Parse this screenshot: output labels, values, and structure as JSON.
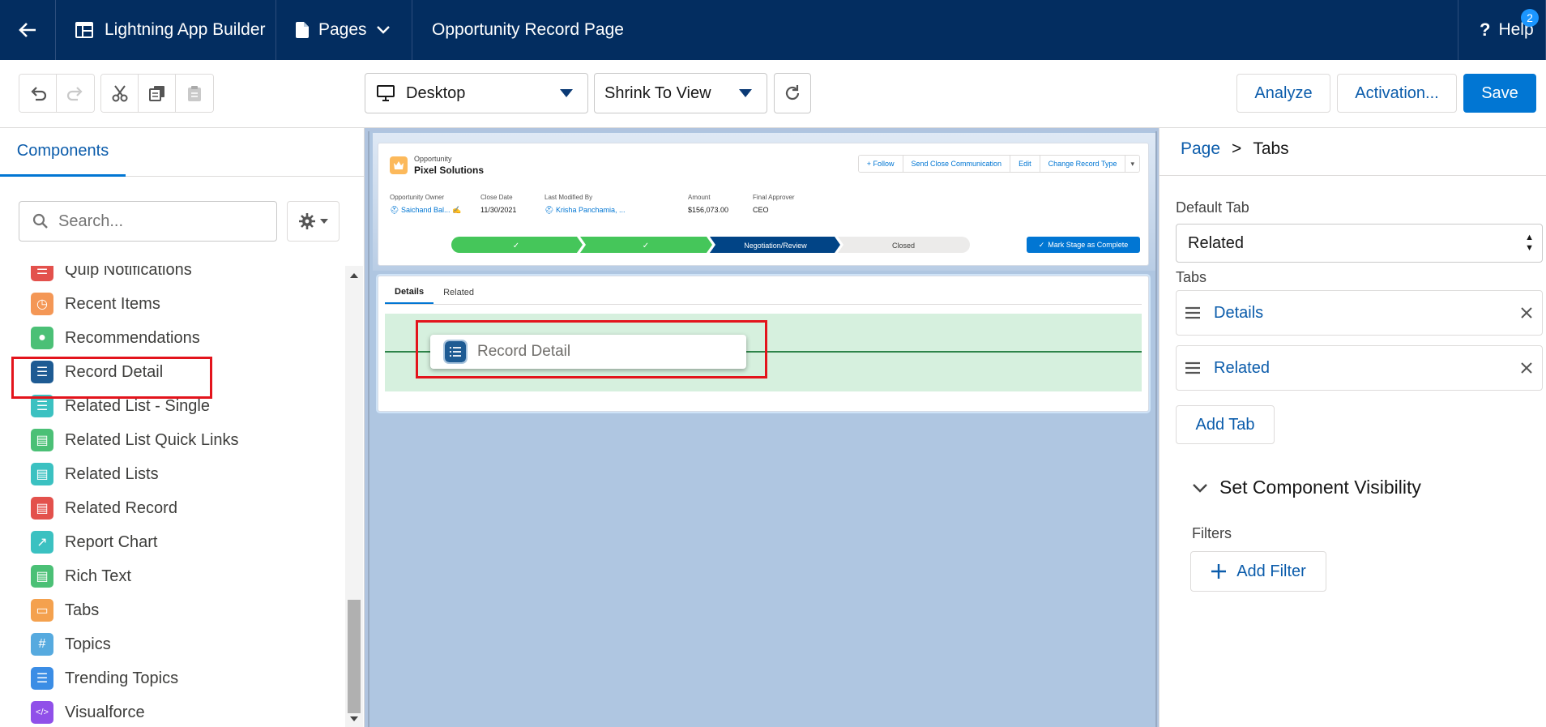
{
  "header": {
    "app_title": "Lightning App Builder",
    "pages_label": "Pages",
    "record_page_title": "Opportunity Record Page",
    "help_label": "Help",
    "help_badge": "2"
  },
  "toolbar": {
    "device": "Desktop",
    "zoom": "Shrink To View",
    "analyze": "Analyze",
    "activation": "Activation...",
    "save": "Save"
  },
  "left_panel": {
    "tab": "Components",
    "search_placeholder": "Search...",
    "components": [
      {
        "label": "Quip Notifications",
        "icon": "quip-icon",
        "color": "#e3514c"
      },
      {
        "label": "Recent Items",
        "icon": "clock-icon",
        "color": "#f49756"
      },
      {
        "label": "Recommendations",
        "icon": "lightbulb-icon",
        "color": "#4bc076"
      },
      {
        "label": "Record Detail",
        "icon": "record-detail-icon",
        "color": "#1e5b93"
      },
      {
        "label": "Related List - Single",
        "icon": "list-icon",
        "color": "#3bc1c1"
      },
      {
        "label": "Related List Quick Links",
        "icon": "quick-links-icon",
        "color": "#4bc076"
      },
      {
        "label": "Related Lists",
        "icon": "related-lists-icon",
        "color": "#3bc1c1"
      },
      {
        "label": "Related Record",
        "icon": "related-record-icon",
        "color": "#e3514c"
      },
      {
        "label": "Report Chart",
        "icon": "report-chart-icon",
        "color": "#3bc1c1"
      },
      {
        "label": "Rich Text",
        "icon": "rich-text-icon",
        "color": "#4bc076"
      },
      {
        "label": "Tabs",
        "icon": "tabs-icon",
        "color": "#f4a14e"
      },
      {
        "label": "Topics",
        "icon": "hashtag-icon",
        "color": "#56aadf"
      },
      {
        "label": "Trending Topics",
        "icon": "trending-icon",
        "color": "#3b8de5"
      },
      {
        "label": "Visualforce",
        "icon": "code-icon",
        "color": "#9050e9"
      }
    ]
  },
  "canvas": {
    "record": {
      "object_type": "Opportunity",
      "name": "Pixel Solutions",
      "actions": [
        "+ Follow",
        "Send Close Communication",
        "Edit",
        "Change Record Type",
        "▾"
      ],
      "fields": [
        {
          "label": "Opportunity Owner",
          "value": "Saichand Bal...",
          "link": true
        },
        {
          "label": "Close Date",
          "value": "11/30/2021",
          "link": false
        },
        {
          "label": "Last Modified By",
          "value": "Krisha Panchamia, ...",
          "link": true
        },
        {
          "label": "Amount",
          "value": "$156,073.00",
          "link": false
        },
        {
          "label": "Final Approver",
          "value": "CEO",
          "link": false
        }
      ],
      "path_stages": [
        "✓",
        "✓",
        "Negotiation/Review",
        "Closed"
      ],
      "mark_stage_label": "Mark Stage as Complete"
    },
    "tabs": [
      "Details",
      "Related"
    ],
    "drag_component": "Record Detail"
  },
  "right_panel": {
    "breadcrumb_parent": "Page",
    "breadcrumb_sep": ">",
    "breadcrumb_current": "Tabs",
    "default_tab_label": "Default Tab",
    "default_tab_value": "Related",
    "tabs_label": "Tabs",
    "tab_items": [
      "Details",
      "Related"
    ],
    "add_tab": "Add Tab",
    "visibility_title": "Set Component Visibility",
    "filters_label": "Filters",
    "add_filter": "Add Filter"
  },
  "colors": {
    "brand_navy": "#032d60",
    "brand_blue": "#0176d3",
    "highlight_red": "#e3141c",
    "path_complete": "#45c65a",
    "path_current": "#014486",
    "drop_zone": "#d6f0de"
  }
}
